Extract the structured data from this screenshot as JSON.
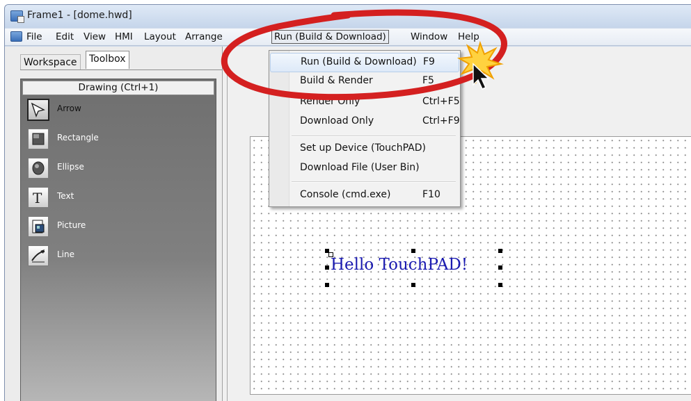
{
  "window": {
    "title": "Frame1 - [dome.hwd]"
  },
  "menubar": {
    "items": [
      "File",
      "Edit",
      "View",
      "HMI",
      "Layout",
      "Arrange",
      "Run (Build & Download)",
      "Window",
      "Help"
    ]
  },
  "left_panel": {
    "tabs": [
      "Workspace",
      "Toolbox"
    ],
    "active_tab": "Toolbox",
    "toolbox_header": "Drawing (Ctrl+1)",
    "tools": [
      {
        "label": "Arrow",
        "icon": "arrow-icon",
        "selected": true
      },
      {
        "label": "Rectangle",
        "icon": "rectangle-icon"
      },
      {
        "label": "Ellipse",
        "icon": "ellipse-icon"
      },
      {
        "label": "Text",
        "icon": "text-icon"
      },
      {
        "label": "Picture",
        "icon": "picture-icon"
      },
      {
        "label": "Line",
        "icon": "line-icon"
      }
    ]
  },
  "run_menu": {
    "items": [
      {
        "label": "Run (Build & Download)",
        "shortcut": "F9",
        "highlighted": true
      },
      {
        "label": "Build & Render",
        "shortcut": "F5"
      },
      {
        "label": "Render Only",
        "shortcut": "Ctrl+F5"
      },
      {
        "label": "Download Only",
        "shortcut": "Ctrl+F9"
      },
      {
        "label": "Set up Device (TouchPAD)",
        "shortcut": ""
      },
      {
        "label": "Download File (User Bin)",
        "shortcut": ""
      },
      {
        "label": "Console (cmd.exe)",
        "shortcut": "F10"
      }
    ]
  },
  "canvas": {
    "text_object": "Hello TouchPAD!",
    "text_color": "#1a1ab0"
  },
  "colors": {
    "annotation_red": "#d42020",
    "burst_yellow": "#ffd23f"
  }
}
